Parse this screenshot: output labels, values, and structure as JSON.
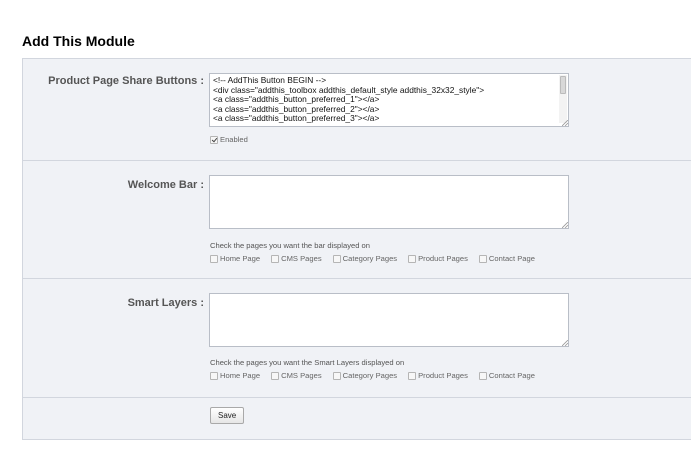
{
  "page": {
    "title": "Add This Module"
  },
  "share_buttons": {
    "label": "Product Page Share Buttons :",
    "code": "<!-- AddThis Button BEGIN -->\n<div class=\"addthis_toolbox addthis_default_style addthis_32x32_style\">\n<a class=\"addthis_button_preferred_1\"></a>\n<a class=\"addthis_button_preferred_2\"></a>\n<a class=\"addthis_button_preferred_3\"></a>",
    "enabled_label": "Enabled",
    "enabled": true
  },
  "welcome_bar": {
    "label": "Welcome Bar :",
    "value": "",
    "helper": "Check the pages you want the bar displayed on",
    "pages": [
      {
        "label": "Home Page",
        "checked": false
      },
      {
        "label": "CMS Pages",
        "checked": false
      },
      {
        "label": "Category Pages",
        "checked": false
      },
      {
        "label": "Product Pages",
        "checked": false
      },
      {
        "label": "Contact Page",
        "checked": false
      }
    ]
  },
  "smart_layers": {
    "label": "Smart Layers :",
    "value": "",
    "helper": "Check the pages you want the Smart Layers displayed on",
    "pages": [
      {
        "label": "Home Page",
        "checked": false
      },
      {
        "label": "CMS Pages",
        "checked": false
      },
      {
        "label": "Category Pages",
        "checked": false
      },
      {
        "label": "Product Pages",
        "checked": false
      },
      {
        "label": "Contact Page",
        "checked": false
      }
    ]
  },
  "actions": {
    "save_label": "Save"
  }
}
